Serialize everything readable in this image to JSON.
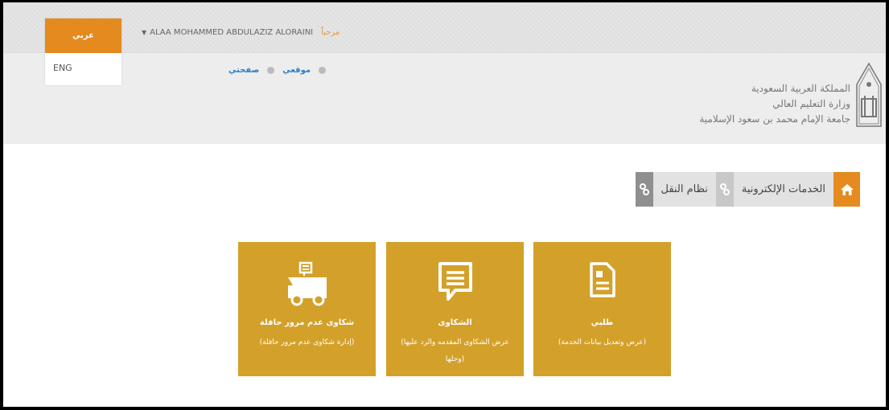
{
  "lang": {
    "arabic": "عربي",
    "english": "ENG"
  },
  "topbar": {
    "greeting": "مرحباً",
    "user_name": "ALAA MOHAMMED ABDULAZIZ ALORAINI"
  },
  "breadcrumb": {
    "site": "موقعي",
    "page": "صفحتي"
  },
  "org": {
    "line1": "المملكة العربية السعودية",
    "line2": "وزارة التعليم العالي",
    "line3": "جامعة الإمام محمد بن سعود الإسلامية"
  },
  "tabs": {
    "eservices": "الخدمات الإلكترونية",
    "transport": "نظام النقل"
  },
  "tiles": [
    {
      "title": "طلبي",
      "desc": "(عرض وتعديل بيانات الخدمة)"
    },
    {
      "title": "الشكاوى",
      "desc": "(عرض الشكاوى المقدمه والرد عليها وحلها)"
    },
    {
      "title": "شكاوى عدم مرور حافلة",
      "desc": "(إدارة شكاوى عدم مرور حافلة)"
    }
  ],
  "colors": {
    "accent": "#e58a1f",
    "tile": "#d3a02a"
  }
}
